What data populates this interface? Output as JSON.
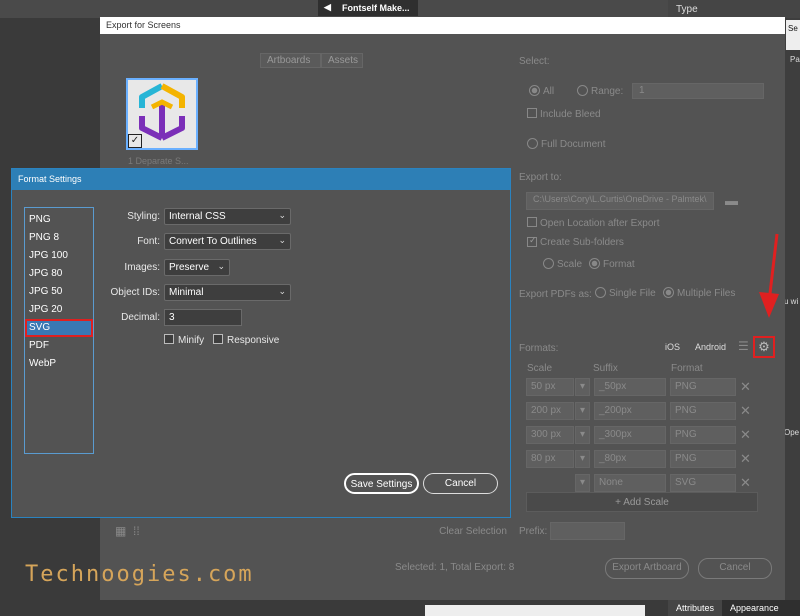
{
  "background": {
    "tab_title": "Fontself Make...",
    "type_panel": "Type",
    "right_strip": [
      "Se",
      "Pa",
      "u wi",
      "Ope"
    ],
    "bottom_tabs": [
      "Attributes",
      "Appearance"
    ]
  },
  "window": {
    "title": "Export for Screens",
    "tabs": [
      "Artboards",
      "Assets"
    ],
    "thumb_label": "1   Deparate S...",
    "select_label": "Select:",
    "all_label": "All",
    "range_label": "Range:",
    "range_value": "1",
    "include_bleed": "Include Bleed",
    "full_document": "Full Document",
    "export_to_label": "Export to:",
    "export_path": "C:\\Users\\Cory\\L.Curtis\\OneDrive - Palmtek\\",
    "open_location": "Open Location after Export",
    "create_subfolders": "Create Sub-folders",
    "scale_opt": "Scale",
    "format_opt": "Format",
    "export_pdfs_label": "Export PDFs as:",
    "single_file": "Single File",
    "multiple_files": "Multiple Files",
    "formats_label": "Formats:",
    "ios": "iOS",
    "android": "Android",
    "col_scale": "Scale",
    "col_suffix": "Suffix",
    "col_format": "Format",
    "rows": [
      {
        "scale": "50 px",
        "suffix": "_50px",
        "format": "PNG"
      },
      {
        "scale": "200 px",
        "suffix": "_200px",
        "format": "PNG"
      },
      {
        "scale": "300 px",
        "suffix": "_300px",
        "format": "PNG"
      },
      {
        "scale": "80 px",
        "suffix": "_80px",
        "format": "PNG"
      },
      {
        "scale": "",
        "suffix": "None",
        "format": "SVG"
      }
    ],
    "add_scale": "+ Add Scale",
    "clear_selection": "Clear Selection",
    "prefix_label": "Prefix:",
    "status": "Selected: 1, Total Export: 8",
    "export_button": "Export Artboard",
    "cancel_button": "Cancel"
  },
  "format_settings": {
    "title": "Format Settings",
    "formats": [
      "PNG",
      "PNG 8",
      "JPG 100",
      "JPG 80",
      "JPG 50",
      "JPG 20",
      "SVG",
      "PDF",
      "WebP"
    ],
    "selected_format": "SVG",
    "styling_label": "Styling:",
    "styling_value": "Internal CSS",
    "font_label": "Font:",
    "font_value": "Convert To Outlines",
    "images_label": "Images:",
    "images_value": "Preserve",
    "object_ids_label": "Object IDs:",
    "object_ids_value": "Minimal",
    "decimal_label": "Decimal:",
    "decimal_value": "3",
    "minify_label": "Minify",
    "responsive_label": "Responsive",
    "save_button": "Save Settings",
    "cancel_button": "Cancel"
  },
  "watermark": "Technoogies.com",
  "colors": {
    "highlight_red": "#e02020",
    "dialog_blue": "#2d7fb6",
    "watermark": "#d6a55a"
  }
}
